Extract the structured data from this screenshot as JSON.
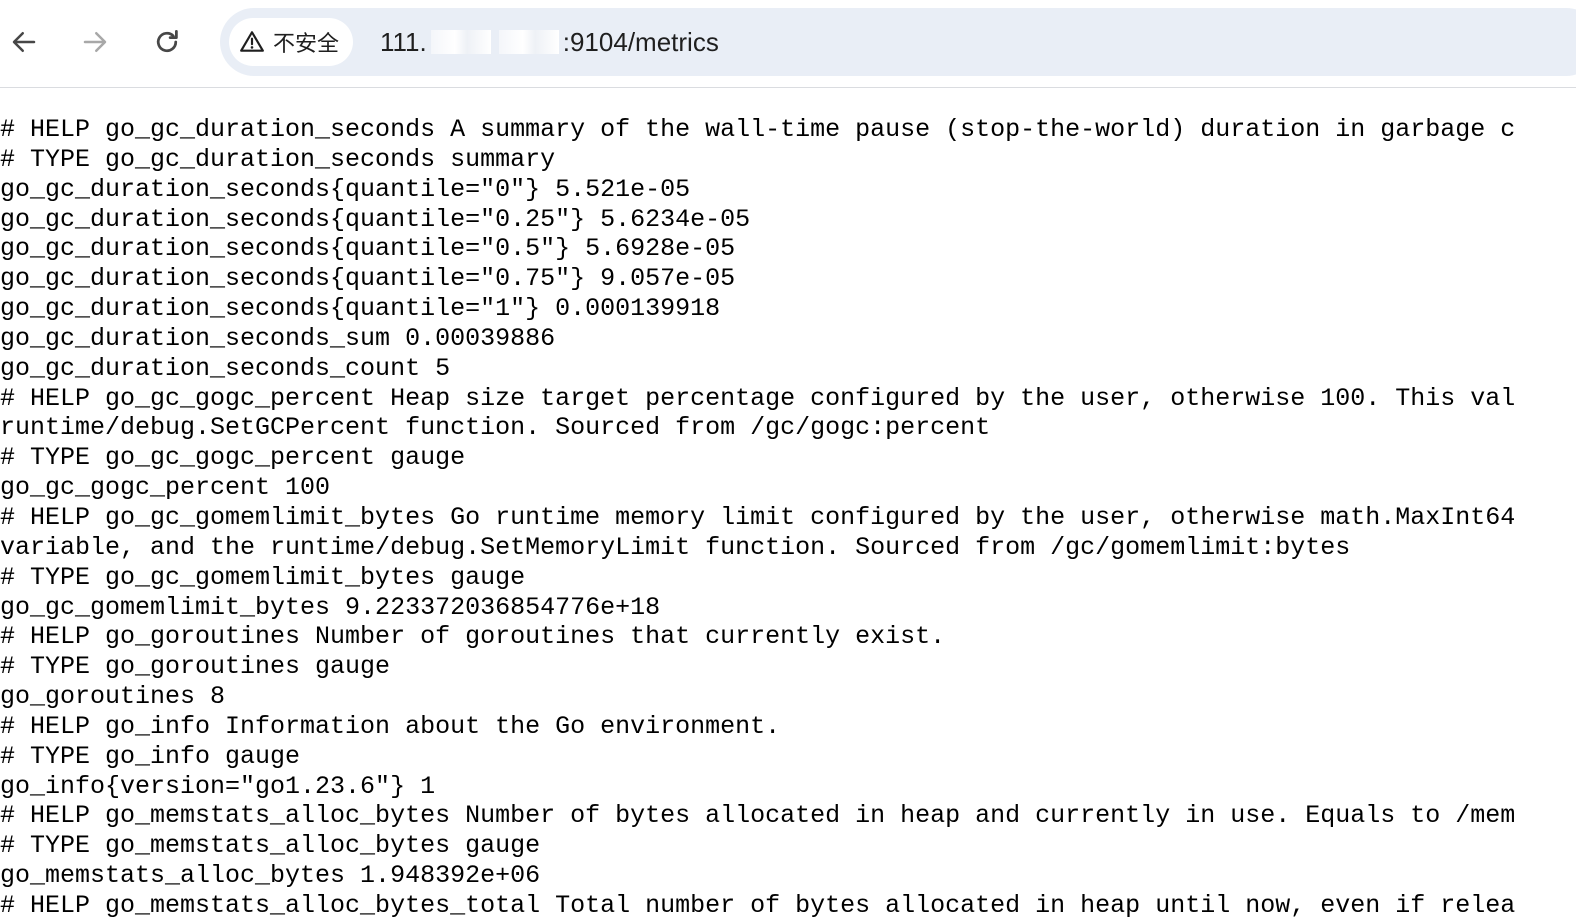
{
  "browser": {
    "back_icon": "arrow-left-icon",
    "forward_icon": "arrow-right-icon",
    "reload_icon": "reload-icon",
    "security_icon": "warning-triangle-icon",
    "security_label": "不安全",
    "url_prefix": "111.",
    "url_suffix": ":9104/metrics"
  },
  "metrics_lines": [
    "# HELP go_gc_duration_seconds A summary of the wall-time pause (stop-the-world) duration in garbage c",
    "# TYPE go_gc_duration_seconds summary",
    "go_gc_duration_seconds{quantile=\"0\"} 5.521e-05",
    "go_gc_duration_seconds{quantile=\"0.25\"} 5.6234e-05",
    "go_gc_duration_seconds{quantile=\"0.5\"} 5.6928e-05",
    "go_gc_duration_seconds{quantile=\"0.75\"} 9.057e-05",
    "go_gc_duration_seconds{quantile=\"1\"} 0.000139918",
    "go_gc_duration_seconds_sum 0.00039886",
    "go_gc_duration_seconds_count 5",
    "# HELP go_gc_gogc_percent Heap size target percentage configured by the user, otherwise 100. This val",
    "runtime/debug.SetGCPercent function. Sourced from /gc/gogc:percent",
    "# TYPE go_gc_gogc_percent gauge",
    "go_gc_gogc_percent 100",
    "# HELP go_gc_gomemlimit_bytes Go runtime memory limit configured by the user, otherwise math.MaxInt64",
    "variable, and the runtime/debug.SetMemoryLimit function. Sourced from /gc/gomemlimit:bytes",
    "# TYPE go_gc_gomemlimit_bytes gauge",
    "go_gc_gomemlimit_bytes 9.223372036854776e+18",
    "# HELP go_goroutines Number of goroutines that currently exist.",
    "# TYPE go_goroutines gauge",
    "go_goroutines 8",
    "# HELP go_info Information about the Go environment.",
    "# TYPE go_info gauge",
    "go_info{version=\"go1.23.6\"} 1",
    "# HELP go_memstats_alloc_bytes Number of bytes allocated in heap and currently in use. Equals to /mem",
    "# TYPE go_memstats_alloc_bytes gauge",
    "go_memstats_alloc_bytes 1.948392e+06",
    "# HELP go_memstats_alloc_bytes_total Total number of bytes allocated in heap until now, even if relea"
  ]
}
